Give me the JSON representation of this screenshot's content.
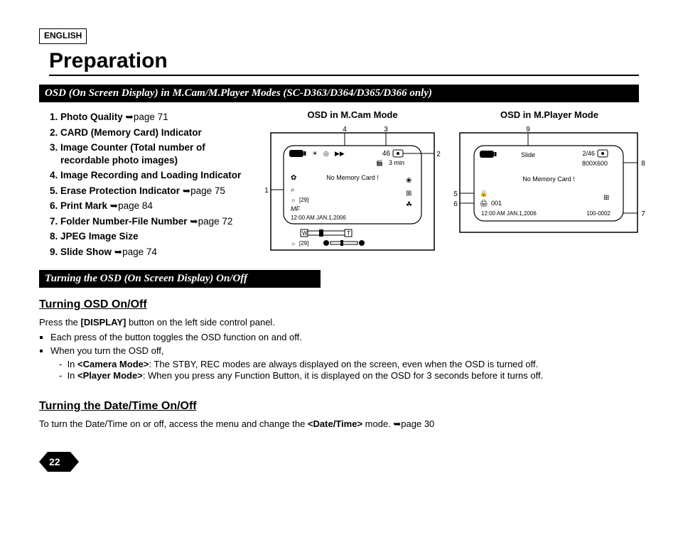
{
  "lang": "ENGLISH",
  "title": "Preparation",
  "bar1": "OSD (On Screen Display) in M.Cam/M.Player Modes (SC-D363/D364/D365/D366 only)",
  "list": {
    "i1": "Photo Quality",
    "i1p": "page 71",
    "i2": "CARD (Memory Card) Indicator",
    "i3": "Image Counter (Total number of recordable photo images)",
    "i4": "Image Recording and Loading Indicator",
    "i5": "Erase Protection Indicator",
    "i5p": "page 75",
    "i6": "Print Mark",
    "i6p": "page 84",
    "i7": "Folder Number-File Number",
    "i7p": "page 72",
    "i8": "JPEG Image Size",
    "i9": "Slide Show",
    "i9p": "page 74"
  },
  "fig1": {
    "title": "OSD in M.Cam Mode",
    "counter46": "46",
    "tape": "3 min",
    "msg": "No Memory Card !",
    "n29a": "[29]",
    "mf": "MF",
    "datetime": "12:00 AM JAN.1,2006",
    "n29b": "[29]",
    "cal1": "1",
    "cal2": "2",
    "cal3": "3",
    "cal4": "4",
    "W": "W",
    "T": "T"
  },
  "fig2": {
    "title": "OSD in M.Player Mode",
    "slide": "Slide",
    "frac": "2/46",
    "res": "800X600",
    "msg": "No Memory Card !",
    "num001": "001",
    "datetime": "12:00 AM JAN.1,2006",
    "folder": "100-0002",
    "cal5": "5",
    "cal6": "6",
    "cal7": "7",
    "cal8": "8",
    "cal9": "9"
  },
  "bar2": "Turning the OSD (On Screen Display) On/Off",
  "sec1_title": "Turning OSD On/Off",
  "sec1_intro_a": "Press the ",
  "sec1_intro_b": "[DISPLAY]",
  "sec1_intro_c": " button on the left side control panel.",
  "sec1_b1": "Each press of the button toggles the OSD function on and off.",
  "sec1_b2": "When you turn the OSD off,",
  "sec1_d1a": "In ",
  "sec1_d1b": "<Camera Mode>",
  "sec1_d1c": ": The STBY, REC modes are always displayed on the screen, even when the OSD is turned off.",
  "sec1_d2a": "In ",
  "sec1_d2b": "<Player Mode>",
  "sec1_d2c": ": When you press any Function Button, it is displayed on the OSD for 3 seconds before it turns off.",
  "sec2_title": "Turning the Date/Time On/Off",
  "sec2_body_a": "To turn the Date/Time on or off, access the menu and change the ",
  "sec2_body_b": "<Date/Time>",
  "sec2_body_c": " mode. ➥page 30",
  "pagenum": "22"
}
